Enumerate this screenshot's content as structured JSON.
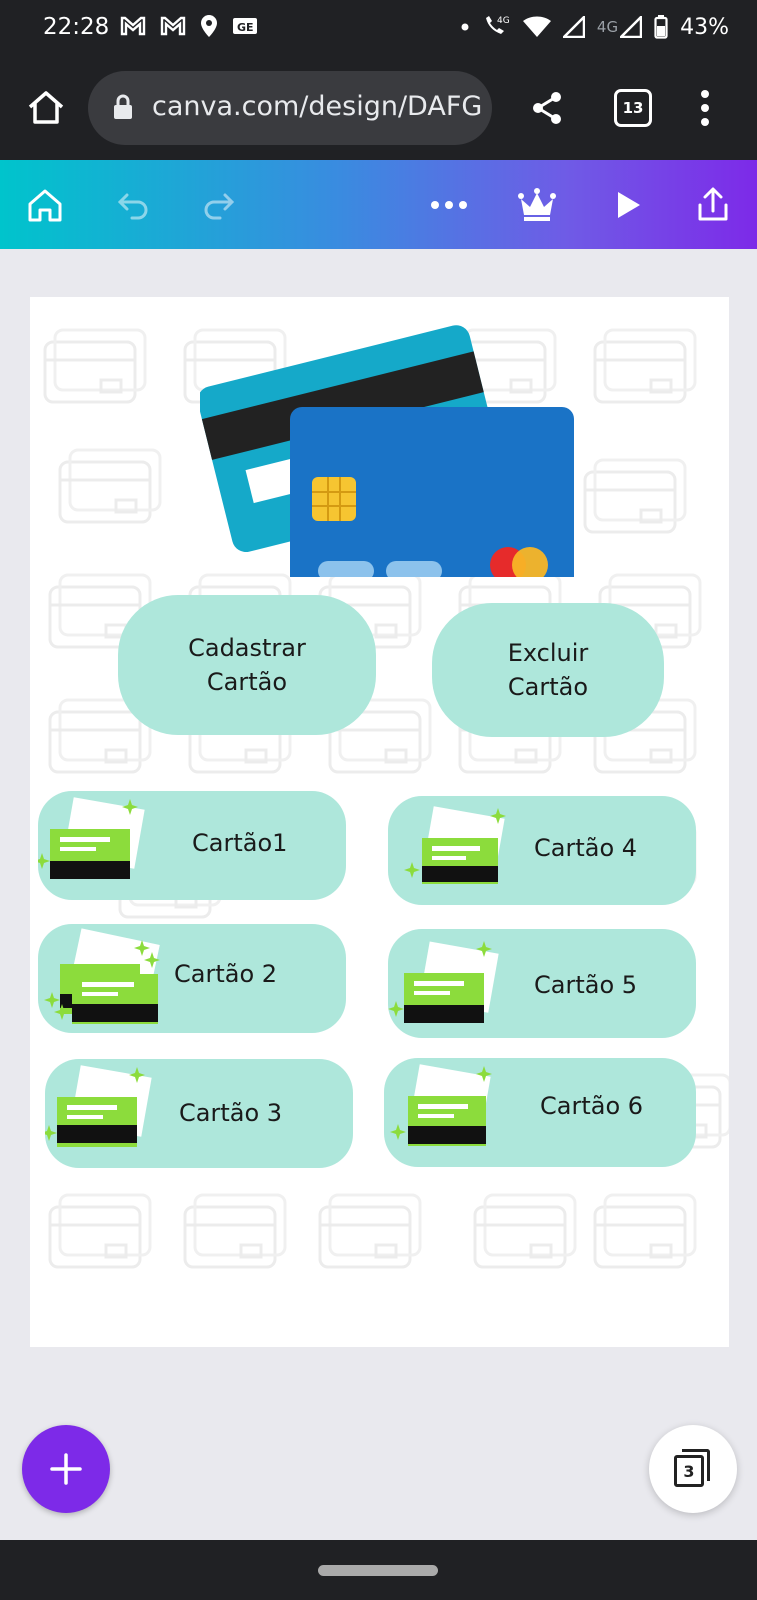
{
  "status": {
    "time": "22:28",
    "network": "4G",
    "battery": "43%",
    "icons": [
      "gmail-icon",
      "gmail-icon",
      "location-icon",
      "news-icon",
      "dot-icon",
      "call-4g-icon",
      "wifi-icon",
      "signal-icon",
      "signal-icon",
      "battery-icon"
    ]
  },
  "browser": {
    "url": "canva.com/design/DAFG",
    "tab_count": "13"
  },
  "toolbar": {
    "icons": [
      "home-icon",
      "undo-icon",
      "redo-icon",
      "more-icon",
      "crown-icon",
      "play-icon",
      "share-icon"
    ]
  },
  "design": {
    "primary_buttons": [
      {
        "line1": "Cadastrar",
        "line2": "Cartão"
      },
      {
        "line1": "Excluir",
        "line2": "Cartão"
      }
    ],
    "cards": [
      {
        "label": "Cartão1"
      },
      {
        "label": "Cartão 4"
      },
      {
        "label": "Cartão 2"
      },
      {
        "label": "Cartão 5"
      },
      {
        "label": "Cartão 3"
      },
      {
        "label": "Cartão 6"
      }
    ]
  },
  "fab": {
    "page_count": "3"
  },
  "colors": {
    "accent": "#7d2ae8",
    "button_mint": "#aee7db",
    "card_green": "#8cdc3c",
    "toolbar_start": "#00c4cc",
    "toolbar_end": "#7d2ae8"
  }
}
